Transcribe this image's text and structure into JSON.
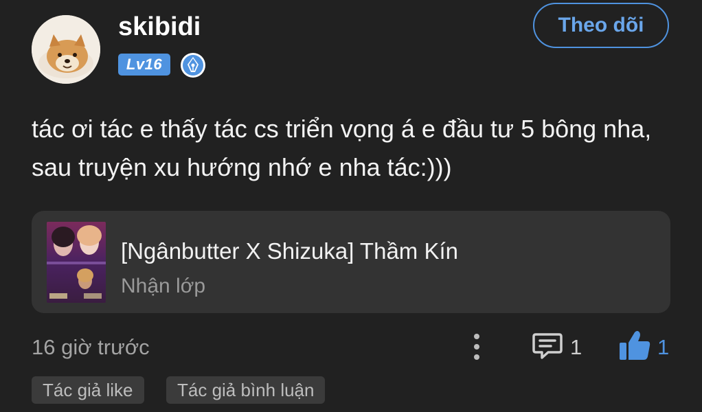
{
  "user": {
    "name": "skibidi",
    "level_badge": "Lv16",
    "avatar_icon": "shiba-dog-avatar",
    "author_badge_icon": "pen-nib-icon"
  },
  "follow_button": {
    "label": "Theo dõi"
  },
  "comment": {
    "text": "tác ơi tác e thấy tác cs triển vọng á e đầu tư 5 bông nha, sau truyện xu hướng nhớ e nha tác:)))"
  },
  "story": {
    "title": "[Ngânbutter X Shizuka] Thầm Kín",
    "subtitle": "Nhận lớp",
    "cover_icon": "story-cover-image"
  },
  "meta": {
    "time": "16 giờ trước",
    "reply_count": "1",
    "like_count": "1"
  },
  "tags": [
    "Tác giả like",
    "Tác giả bình luận"
  ],
  "colors": {
    "background": "#212121",
    "accent": "#4f93e0",
    "card": "#333333",
    "muted": "#a4a4a4"
  }
}
